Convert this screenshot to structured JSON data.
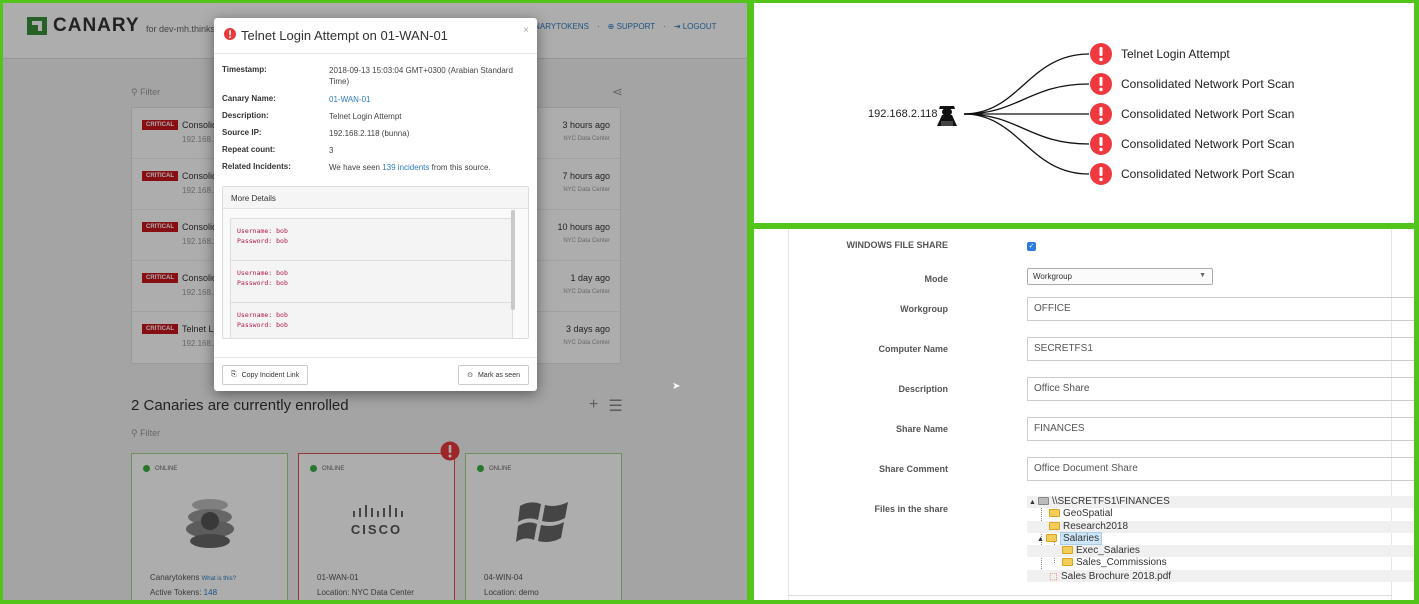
{
  "left": {
    "brand": "CANARY",
    "brand_sub": "for dev-mh.thinkst",
    "nav": [
      "CANARYTOKENS",
      "SUPPORT",
      "LOGOUT"
    ],
    "filter_placeholder": "Filter",
    "incidents": [
      {
        "severity": "CRITICAL",
        "title": "Consolid",
        "ip": "192.168.2.1",
        "time": "3 hours ago",
        "location": "NYC Data Center"
      },
      {
        "severity": "CRITICAL",
        "title": "Consolid",
        "ip": "192.168.2.1",
        "time": "7 hours ago",
        "location": "NYC Data Center"
      },
      {
        "severity": "CRITICAL",
        "title": "Consolid",
        "ip": "192.168.2.1",
        "time": "10 hours ago",
        "location": "NYC Data Center"
      },
      {
        "severity": "CRITICAL",
        "title": "Consolid",
        "ip": "192.168.2.1",
        "time": "1 day ago",
        "location": "NYC Data Center"
      },
      {
        "severity": "CRITICAL",
        "title": "Telnet Lo",
        "ip": "192.168.2.1",
        "time": "3 days ago",
        "location": "NYC Data Center"
      }
    ],
    "enrolled_heading": "2 Canaries are currently enrolled",
    "cards": [
      {
        "status": "ONLINE",
        "name": "Canarytokens",
        "name_link": "What is this?",
        "sub_label": "Active Tokens:",
        "sub_value": "148"
      },
      {
        "status": "ONLINE",
        "name": "01-WAN-01",
        "sub_label": "Location: NYC Data Center",
        "logo_text": "CISCO"
      },
      {
        "status": "ONLINE",
        "name": "04-WIN-04",
        "sub_label": "Location: demo"
      }
    ],
    "modal": {
      "title": "Telnet Login Attempt on 01-WAN-01",
      "close": "×",
      "fields": {
        "timestamp_label": "Timestamp:",
        "timestamp_value": "2018-09-13 15:03:04 GMT+0300 (Arabian Standard Time)",
        "canary_label": "Canary Name:",
        "canary_value": "01-WAN-01",
        "description_label": "Description:",
        "description_value": "Telnet Login Attempt",
        "source_label": "Source IP:",
        "source_value": "192.168.2.118 (bunna)",
        "repeat_label": "Repeat count:",
        "repeat_value": "3",
        "related_label": "Related Incidents:",
        "related_pre": "We have seen ",
        "related_link": "139 incidents",
        "related_post": " from this source."
      },
      "more_details": "More Details",
      "credentials": [
        {
          "user": "Username: bob",
          "pass": "Password: bob"
        },
        {
          "user": "Username: bob",
          "pass": "Password: bob"
        },
        {
          "user": "Username: bob",
          "pass": "Password: bob"
        }
      ],
      "copy_button": "Copy Incident Link",
      "seen_button": "Mark as seen"
    }
  },
  "top_right": {
    "source_ip": "192.168.2.118",
    "alerts": [
      "Telnet Login Attempt",
      "Consolidated Network Port Scan",
      "Consolidated Network Port Scan",
      "Consolidated Network Port Scan",
      "Consolidated Network Port Scan"
    ],
    "alert_color": "#f0393e"
  },
  "bottom_right": {
    "labels": {
      "windows_share": "WINDOWS FILE SHARE",
      "mode": "Mode",
      "workgroup": "Workgroup",
      "computer": "Computer Name",
      "description": "Description",
      "share_name": "Share Name",
      "share_comment": "Share Comment",
      "files": "Files in the share"
    },
    "windows_share_checked": true,
    "mode_value": "Workgroup",
    "workgroup_value": "OFFICE",
    "computer_value": "SECRETFS1",
    "description_value": "Office Share",
    "share_name_value": "FINANCES",
    "share_comment_value": "Office Document Share",
    "tree": {
      "root": "\\\\SECRETFS1\\FINANCES",
      "geo": "GeoSpatial",
      "research": "Research2018",
      "salaries": "Salaries",
      "exec": "Exec_Salaries",
      "commissions": "Sales_Commissions",
      "brochure": "Sales Brochure 2018.pdf"
    }
  }
}
